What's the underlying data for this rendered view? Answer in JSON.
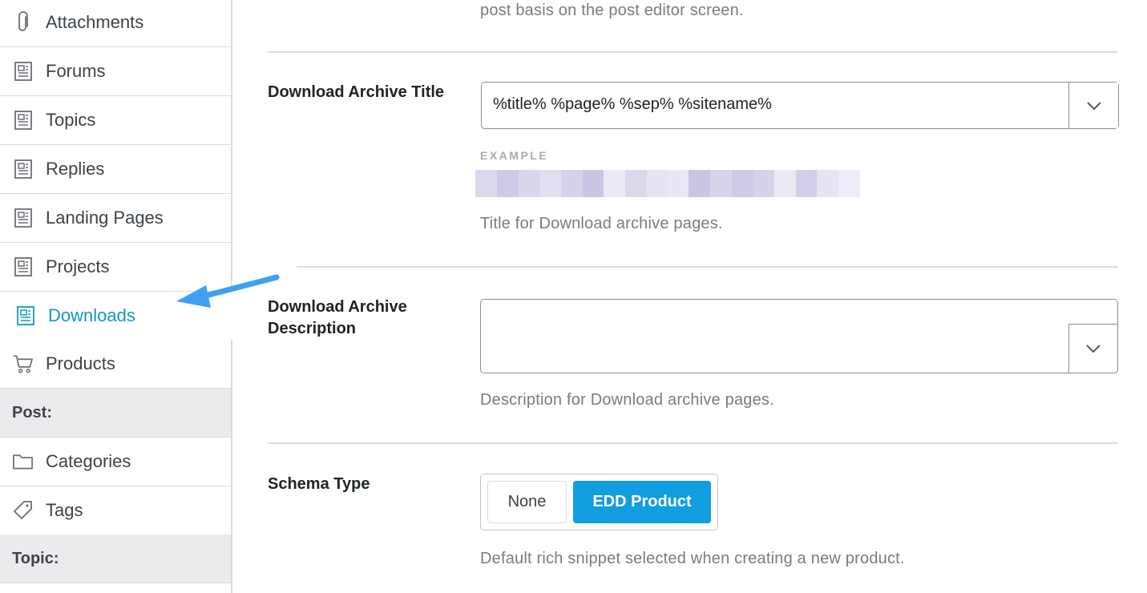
{
  "sidebar": {
    "items": [
      {
        "label": "Attachments",
        "icon": "paperclip-icon"
      },
      {
        "label": "Forums",
        "icon": "page-icon"
      },
      {
        "label": "Topics",
        "icon": "page-icon"
      },
      {
        "label": "Replies",
        "icon": "page-icon"
      },
      {
        "label": "Landing Pages",
        "icon": "page-icon"
      },
      {
        "label": "Projects",
        "icon": "page-icon"
      },
      {
        "label": "Downloads",
        "icon": "page-icon",
        "active": true
      },
      {
        "label": "Products",
        "icon": "cart-icon"
      }
    ],
    "post_section": "Post:",
    "post_items": [
      {
        "label": "Categories",
        "icon": "folder-icon"
      },
      {
        "label": "Tags",
        "icon": "tag-icon"
      }
    ],
    "topic_section": "Topic:"
  },
  "main": {
    "top_partial_text": "post basis on the post editor screen.",
    "archive_title": {
      "label": "Download Archive Title",
      "value": "%title% %page% %sep% %sitename%",
      "example_label": "EXAMPLE",
      "description": "Title for Download archive pages."
    },
    "archive_description": {
      "label_line1": "Download Archive",
      "label_line2": "Description",
      "value": "",
      "description": "Description for Download archive pages."
    },
    "schema_type": {
      "label": "Schema Type",
      "options": [
        "None",
        "EDD Product"
      ],
      "selected": "EDD Product",
      "description": "Default rich snippet selected when creating a new product."
    }
  },
  "colors": {
    "accent": "#109ee0",
    "active_link": "#1496c8",
    "annotation_arrow": "#3ea0f0"
  }
}
